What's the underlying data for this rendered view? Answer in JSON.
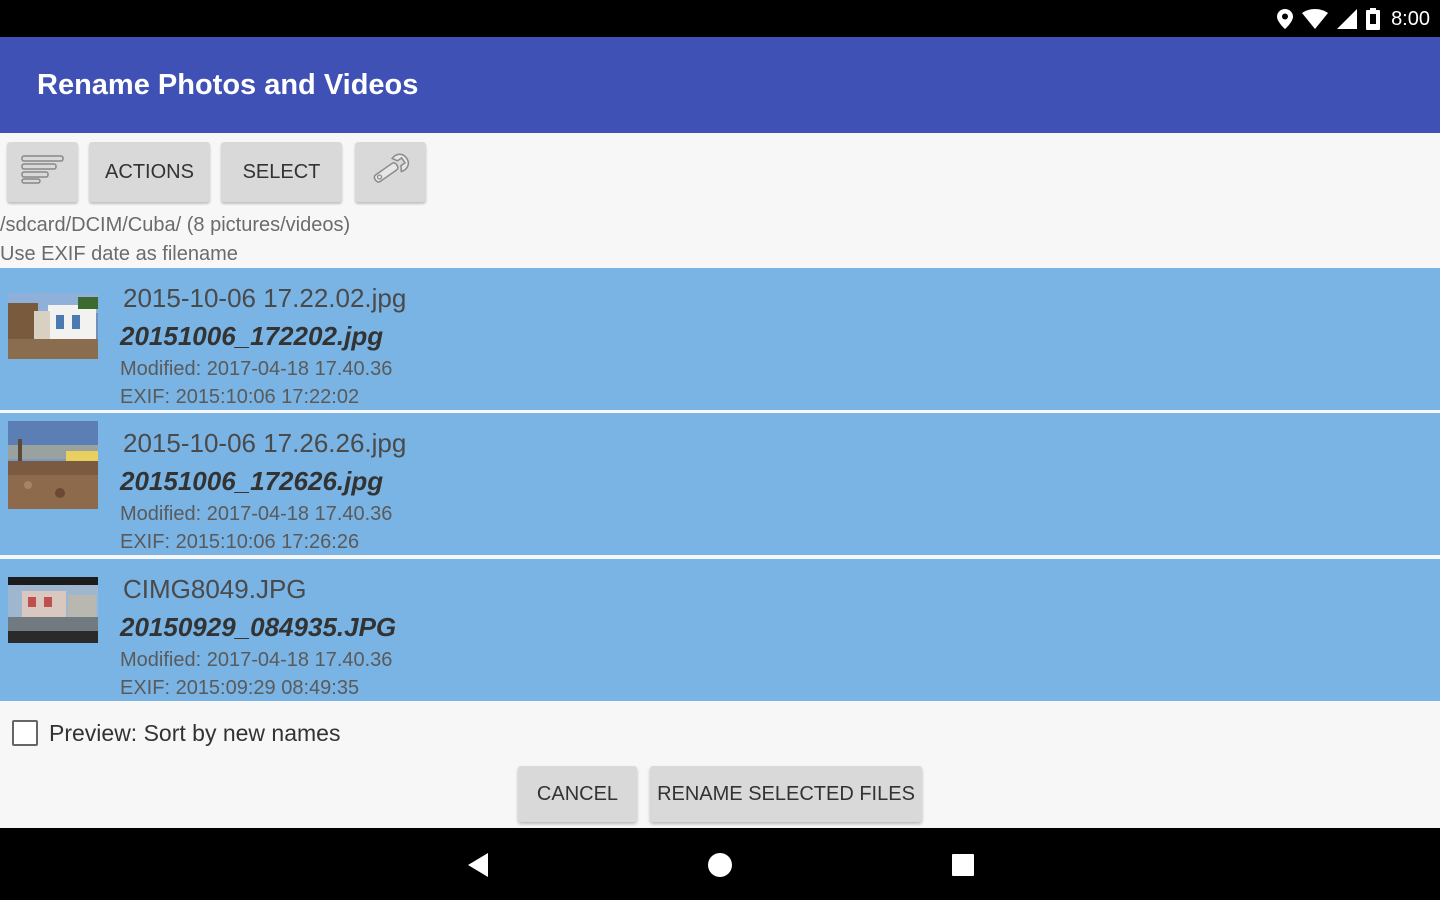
{
  "status_bar": {
    "time": "8:00",
    "icons": [
      "location-icon",
      "wifi-icon",
      "signal-icon",
      "battery-icon"
    ]
  },
  "app": {
    "title": "Rename Photos and Videos",
    "accent_color": "#3f51b5"
  },
  "toolbar": {
    "sort_icon": "sort-lines-icon",
    "actions_label": "ACTIONS",
    "select_label": "SELECT",
    "settings_icon": "wrench-icon"
  },
  "info": {
    "path": "/sdcard/DCIM/Cuba/ (8 pictures/videos)",
    "mode": "Use EXIF date as filename"
  },
  "files": [
    {
      "original": "2015-10-06 17.22.02.jpg",
      "new_name": "20151006_172202.jpg",
      "modified": "Modified: 2017-04-18 17.40.36",
      "exif": "EXIF: 2015:10:06 17:22:02"
    },
    {
      "original": "2015-10-06 17.26.26.jpg",
      "new_name": "20151006_172626.jpg",
      "modified": "Modified: 2017-04-18 17.40.36",
      "exif": "EXIF: 2015:10:06 17:26:26"
    },
    {
      "original": "CIMG8049.JPG",
      "new_name": "20150929_084935.JPG",
      "modified": "Modified: 2017-04-18 17.40.36",
      "exif": "EXIF: 2015:09:29 08:49:35"
    }
  ],
  "selected_row_color": "#79b4e4",
  "preview": {
    "label": "Preview: Sort by new names",
    "checked": false
  },
  "dialog_buttons": {
    "cancel_label": "CANCEL",
    "rename_label": "RENAME SELECTED FILES"
  }
}
